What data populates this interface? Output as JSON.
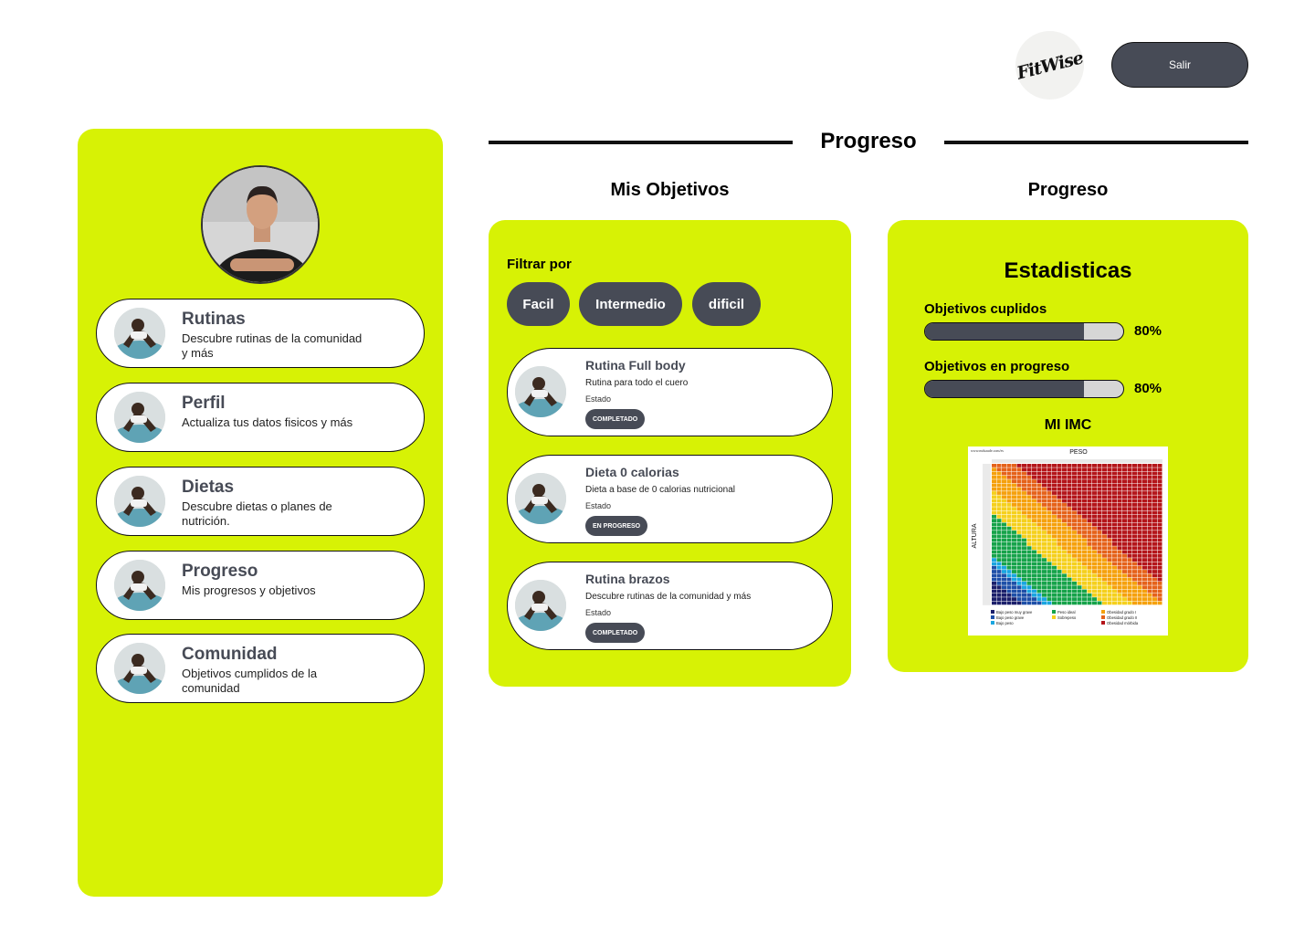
{
  "header": {
    "logo_text": "FitWise",
    "logout_label": "Salir"
  },
  "sidebar": {
    "items": [
      {
        "title": "Rutinas",
        "desc": "Descubre rutinas de la comunidad y más"
      },
      {
        "title": "Perfil",
        "desc": "Actualiza tus datos fisicos y más"
      },
      {
        "title": "Dietas",
        "desc": "Descubre dietas o planes de nutrición."
      },
      {
        "title": "Progreso",
        "desc": "Mis progresos y objetivos"
      },
      {
        "title": "Comunidad",
        "desc": "Objetivos cumplidos de la comunidad"
      }
    ]
  },
  "main": {
    "section_title": "Progreso",
    "objectives_title": "Mis Objetivos",
    "progress_title": "Progreso"
  },
  "objectives": {
    "filter_label": "Filtrar por",
    "filters": [
      "Facil",
      "Intermedio",
      "dificil"
    ],
    "cards": [
      {
        "title": "Rutina Full body",
        "desc": "Rutina para todo el cuero",
        "state_label": "Estado",
        "state": "COMPLETADO"
      },
      {
        "title": "Dieta 0 calorias",
        "desc": "Dieta a base de  0 calorias nutricional",
        "state_label": "Estado",
        "state": "EN PROGRESO"
      },
      {
        "title": "Rutina brazos",
        "desc": "Descubre rutinas de la comunidad y más",
        "state_label": "Estado",
        "state": "COMPLETADO"
      }
    ]
  },
  "stats": {
    "title": "Estadisticas",
    "items": [
      {
        "label": "Objetivos cuplidos",
        "value": "80%",
        "fraction": 0.8
      },
      {
        "label": "Objetivos en progreso",
        "value": "80%",
        "fraction": 0.8
      }
    ],
    "imc_title": "MI IMC",
    "imc_chart": {
      "source": "www.mdsaude.com/es",
      "x_label": "PESO",
      "y_label": "ALTURA",
      "legend": [
        "Bajo peso muy grave",
        "Bajo peso grave",
        "Bajo peso",
        "Peso ideal",
        "Sobrepeso",
        "Obesidad grado I",
        "Obesidad grado II",
        "Obesidad mórbida"
      ]
    }
  },
  "colors": {
    "accent": "#d7f205",
    "dark": "#474b56",
    "imc": [
      "#1b1f6b",
      "#1e4fa8",
      "#1aa6e0",
      "#16a34a",
      "#f5d01d",
      "#f5a10d",
      "#e5621a",
      "#b4151a"
    ]
  },
  "icons": {
    "avatar": "profile-photo",
    "thumb": "pushup-photo"
  }
}
